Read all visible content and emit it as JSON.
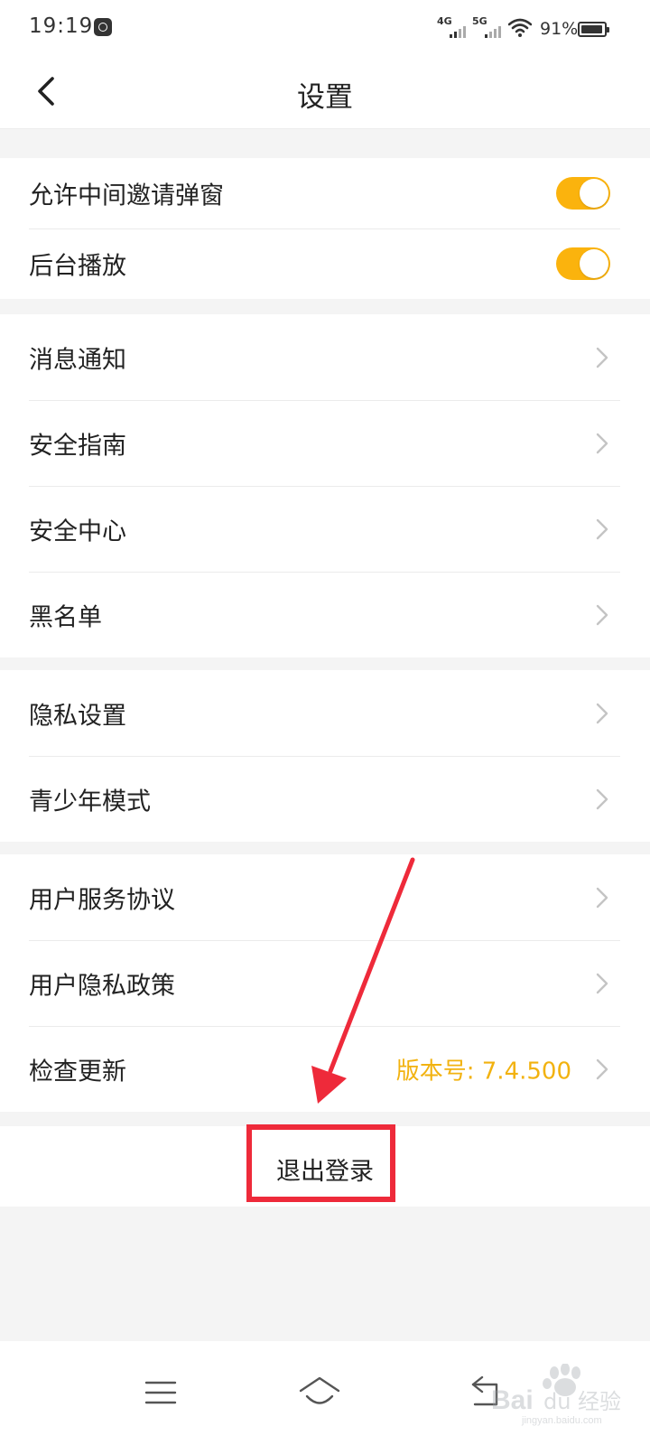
{
  "status_bar": {
    "time": "19:19",
    "net1": "4G",
    "net2": "5G",
    "battery": "91%"
  },
  "header": {
    "title": "设置",
    "back_icon": "chevron-left-icon"
  },
  "groups": [
    {
      "items": [
        {
          "label": "允许中间邀请弹窗",
          "control": "toggle",
          "on": true
        },
        {
          "label": "后台播放",
          "control": "toggle",
          "on": true
        }
      ]
    },
    {
      "items": [
        {
          "label": "消息通知",
          "control": "chevron"
        },
        {
          "label": "安全指南",
          "control": "chevron"
        },
        {
          "label": "安全中心",
          "control": "chevron"
        },
        {
          "label": "黑名单",
          "control": "chevron"
        }
      ]
    },
    {
      "items": [
        {
          "label": "隐私设置",
          "control": "chevron"
        },
        {
          "label": "青少年模式",
          "control": "chevron"
        }
      ]
    },
    {
      "items": [
        {
          "label": "用户服务协议",
          "control": "chevron"
        },
        {
          "label": "用户隐私政策",
          "control": "chevron"
        },
        {
          "label": "检查更新",
          "control": "chevron",
          "value": "版本号: 7.4.500"
        }
      ]
    }
  ],
  "logout": {
    "label": "退出登录"
  },
  "colors": {
    "accent": "#fbb30d",
    "version_text": "#f2b20f",
    "annotation_red": "#ee2a3a",
    "background": "#f4f4f4"
  },
  "watermark": {
    "text": "Baidu经验",
    "subtext": "jingyan.baidu.com"
  }
}
